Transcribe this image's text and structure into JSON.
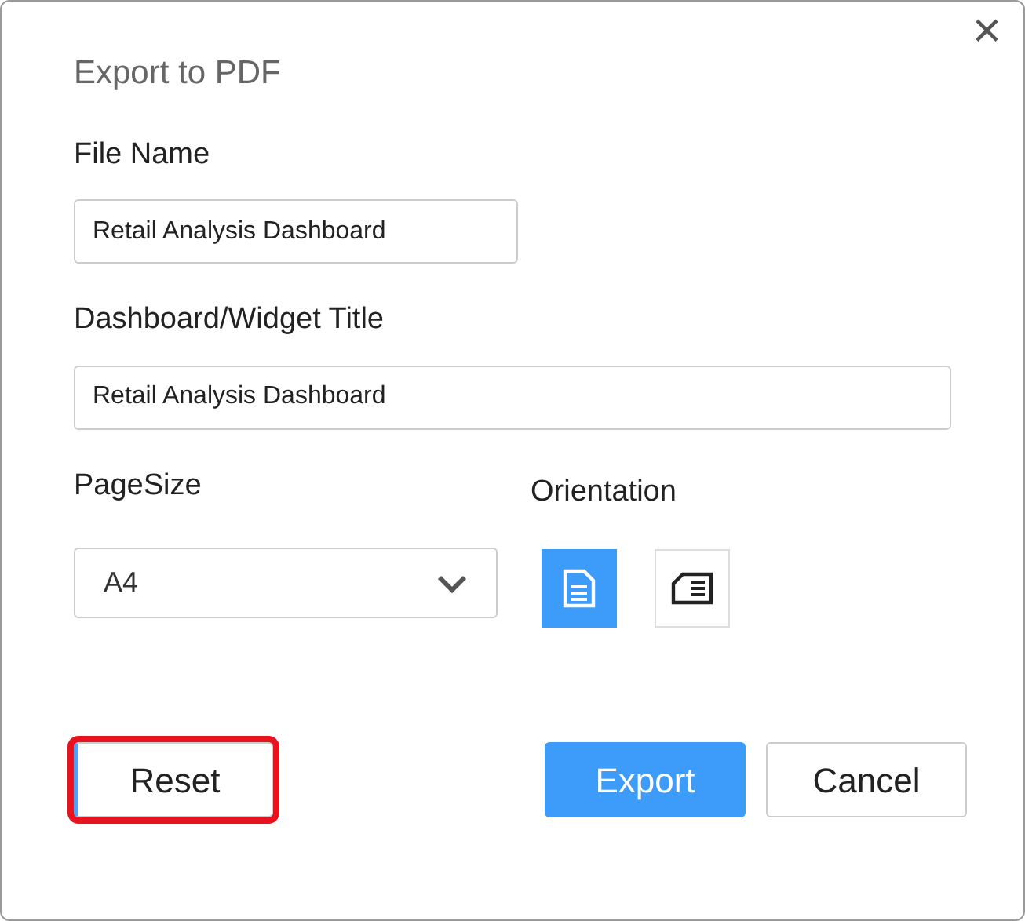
{
  "dialog": {
    "title": "Export to PDF",
    "close": "×"
  },
  "file_name": {
    "label": "File Name",
    "value": "Retail Analysis Dashboard"
  },
  "widget_title": {
    "label": "Dashboard/Widget Title",
    "value": "Retail Analysis Dashboard"
  },
  "page_size": {
    "label": "PageSize",
    "value": "A4"
  },
  "orientation": {
    "label": "Orientation",
    "options": [
      {
        "kind": "portrait",
        "selected": true
      },
      {
        "kind": "landscape",
        "selected": false
      }
    ]
  },
  "buttons": [
    {
      "label": "Reset",
      "kind": "reset",
      "highlighted": true
    },
    {
      "label": "Export",
      "kind": "primary",
      "highlighted": false
    },
    {
      "label": "Cancel",
      "kind": "secondary",
      "highlighted": false
    }
  ]
}
